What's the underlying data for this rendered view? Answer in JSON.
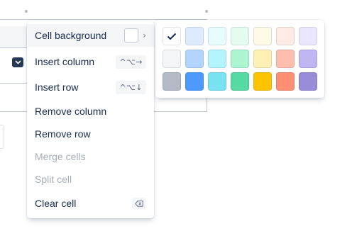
{
  "menu": {
    "items": [
      {
        "label": "Cell background",
        "state": "active",
        "trailing": "swatch",
        "chevron": "›"
      },
      {
        "label": "Insert column",
        "state": "normal",
        "trailing": "shortcut",
        "shortcut": "^⌥→"
      },
      {
        "label": "Insert row",
        "state": "normal",
        "trailing": "shortcut",
        "shortcut": "^⌥↓"
      },
      {
        "label": "Remove column",
        "state": "normal"
      },
      {
        "label": "Remove row",
        "state": "normal"
      },
      {
        "label": "Merge cells",
        "state": "disabled"
      },
      {
        "label": "Split cell",
        "state": "disabled"
      },
      {
        "label": "Clear cell",
        "state": "normal",
        "trailing": "backspace-icon"
      }
    ]
  },
  "palette": {
    "selected": "#ffffff",
    "rows": [
      [
        "#ffffff",
        "#deebff",
        "#e6fcff",
        "#e3fcef",
        "#fffae6",
        "#ffebe6",
        "#eae6ff"
      ],
      [
        "#f4f5f7",
        "#b3d4ff",
        "#b3f5ff",
        "#abf5d1",
        "#fff0b3",
        "#ffbdad",
        "#c0b6f2"
      ],
      [
        "#b3bac5",
        "#4c9aff",
        "#79e2f2",
        "#57d9a3",
        "#ffc400",
        "#ff8f73",
        "#998dd9"
      ]
    ]
  },
  "icons": {
    "cell_handle": "chevron-down-icon",
    "selected_swatch": "checkmark-icon",
    "clear": "backspace-icon"
  }
}
